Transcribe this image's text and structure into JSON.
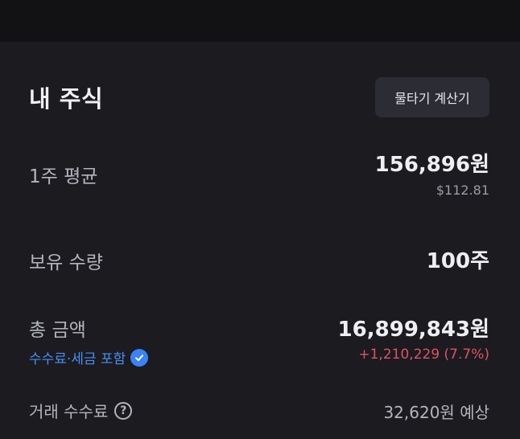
{
  "section": {
    "title": "내 주식",
    "calc_button": "물타기 계산기"
  },
  "avg_price": {
    "label": "1주 평균",
    "value": "156,896원",
    "usd": "$112.81"
  },
  "holdings": {
    "label": "보유 수량",
    "value": "100주"
  },
  "total": {
    "label": "총 금액",
    "value": "16,899,843원",
    "fee_tax_link": "수수료·세금 포함",
    "gain": "+1,210,229 (7.7%)"
  },
  "trade_fee": {
    "label": "거래 수수료",
    "value": "32,620원 예상"
  },
  "icons": {
    "check": "check-circle-icon",
    "help": "question-circle-icon"
  },
  "colors": {
    "accent_blue": "#4a8ef5",
    "gain_red": "#e05263",
    "background": "#1b1b20"
  }
}
